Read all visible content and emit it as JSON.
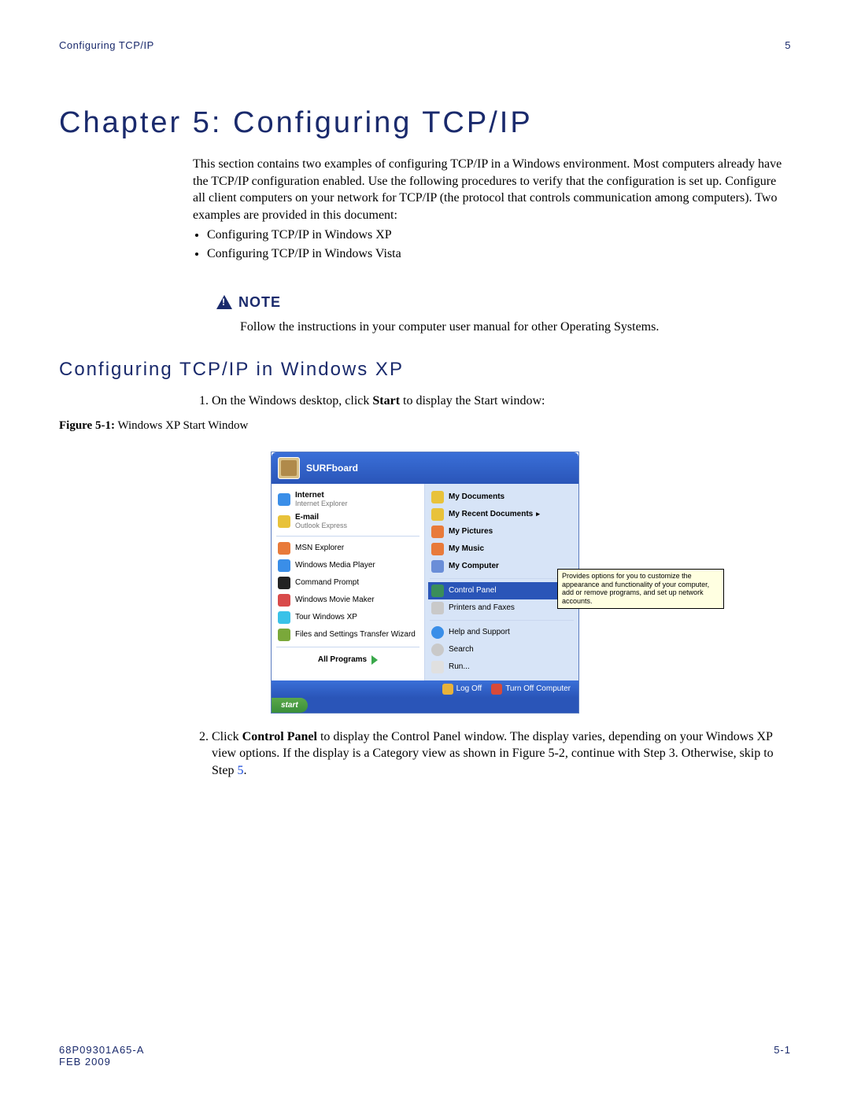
{
  "header": {
    "left": "Configuring TCP/IP",
    "right": "5"
  },
  "chapter_title": "Chapter 5: Configuring TCP/IP",
  "intro_text": "This section contains two examples of configuring TCP/IP in a Windows environment. Most computers already have the TCP/IP configuration enabled. Use the following procedures to verify that the configuration is set up. Configure all client computers on your network for TCP/IP (the protocol that controls communication among computers). Two examples are provided in this document:",
  "intro_bullets": [
    "Configuring TCP/IP in Windows XP",
    "Configuring TCP/IP in Windows Vista"
  ],
  "note": {
    "label": "NOTE",
    "text": "Follow the instructions in your computer user manual for other Operating Systems."
  },
  "section_title": "Configuring TCP/IP in Windows XP",
  "step1_pre": "On the Windows desktop, click ",
  "step1_bold": "Start",
  "step1_post": " to display the Start window:",
  "figure": {
    "label": "Figure 5-1:",
    "caption": " Windows XP Start Window"
  },
  "startmenu": {
    "user": "SURFboard",
    "left": [
      {
        "title": "Internet",
        "sub": "Internet Explorer",
        "icon": "ic-ie"
      },
      {
        "title": "E-mail",
        "sub": "Outlook Express",
        "icon": "ic-mail"
      },
      {
        "title": "MSN Explorer",
        "icon": "ic-msn"
      },
      {
        "title": "Windows Media Player",
        "icon": "ic-wmp"
      },
      {
        "title": "Command Prompt",
        "icon": "ic-cmd"
      },
      {
        "title": "Windows Movie Maker",
        "icon": "ic-wmm"
      },
      {
        "title": "Tour Windows XP",
        "icon": "ic-tour"
      },
      {
        "title": "Files and Settings Transfer Wizard",
        "icon": "ic-fst"
      }
    ],
    "all_programs": "All Programs",
    "right": [
      {
        "title": "My Documents",
        "icon": "ic-doc",
        "bold": true
      },
      {
        "title": "My Recent Documents",
        "icon": "ic-rec",
        "bold": true,
        "arrow": true
      },
      {
        "title": "My Pictures",
        "icon": "ic-pic",
        "bold": true
      },
      {
        "title": "My Music",
        "icon": "ic-mus",
        "bold": true
      },
      {
        "title": "My Computer",
        "icon": "ic-comp",
        "bold": true
      },
      {
        "title": "Control Panel",
        "icon": "ic-cp",
        "selected": true
      },
      {
        "title": "Printers and Faxes",
        "icon": "ic-prn"
      },
      {
        "title": "Help and Support",
        "icon": "ic-help"
      },
      {
        "title": "Search",
        "icon": "ic-search"
      },
      {
        "title": "Run...",
        "icon": "ic-run"
      }
    ],
    "tooltip": "Provides options for you to customize the appearance and functionality of your computer, add or remove programs, and set up network accounts.",
    "logoff": "Log Off",
    "turnoff": "Turn Off Computer",
    "start": "start"
  },
  "step2_pre": "Click ",
  "step2_bold": "Control Panel",
  "step2_mid": " to display the Control Panel window. The display varies, depending on your Windows XP view options. If the display is a Category view as shown in Figure 5-2, continue with Step 3. Otherwise, skip to Step ",
  "step2_link": "5",
  "step2_post": ".",
  "footer": {
    "doc": "68P09301A65-A",
    "date": "FEB 2009",
    "page": "5-1"
  }
}
